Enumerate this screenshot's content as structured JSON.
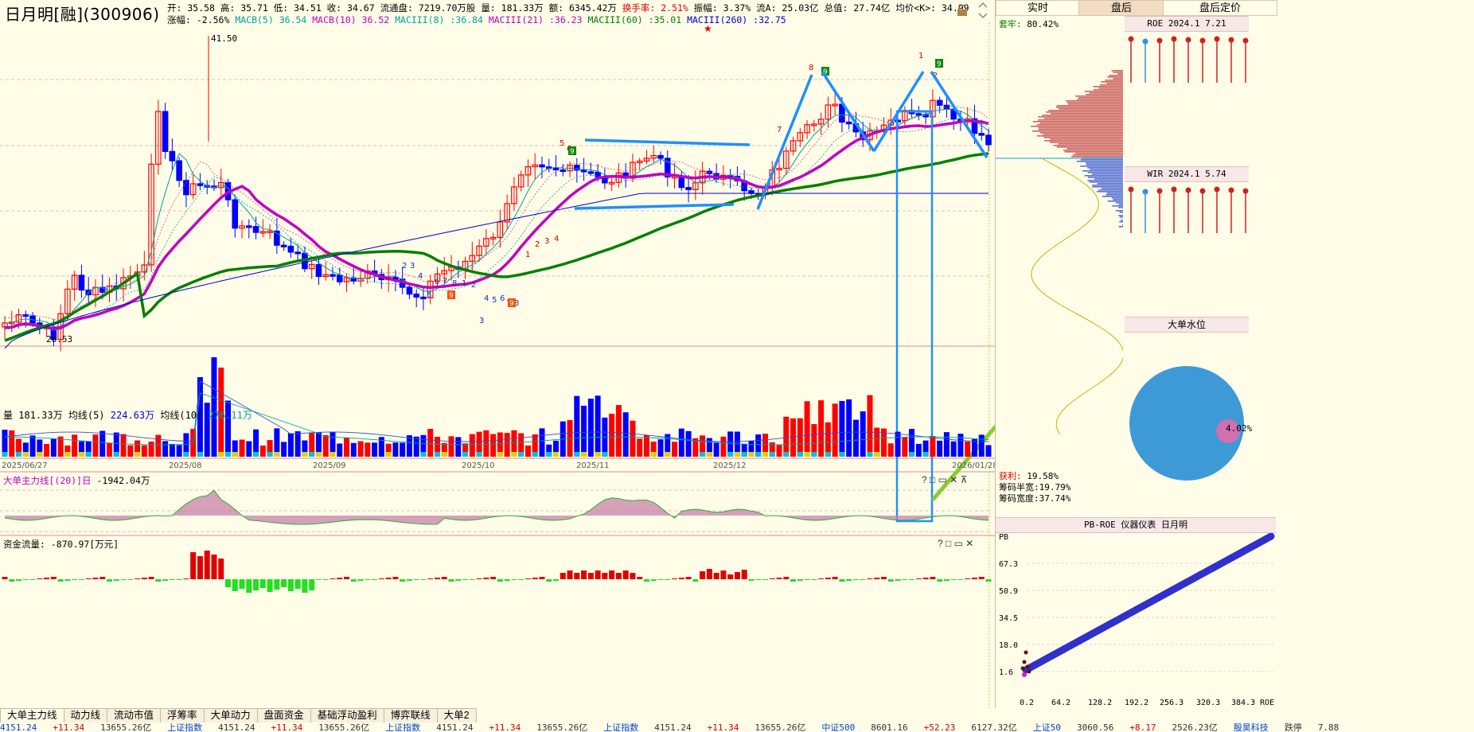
{
  "header": {
    "title": "日月明[融](300906)",
    "ohlc": [
      {
        "label": "开:",
        "value": "35.58"
      },
      {
        "label": "高:",
        "value": "35.71"
      },
      {
        "label": "低:",
        "value": "34.51"
      },
      {
        "label": "收:",
        "value": "34.67"
      },
      {
        "label": "流通盘:",
        "value": "7219.70万股"
      },
      {
        "label": "量:",
        "value": "181.33万"
      },
      {
        "label": "额:",
        "value": "6345.42万"
      },
      {
        "label": "换手率:",
        "value": "2.51%"
      },
      {
        "label": "振幅:",
        "value": "3.37%"
      },
      {
        "label": "流A:",
        "value": "25.03亿"
      },
      {
        "label": "总值:",
        "value": "27.74亿"
      },
      {
        "label": "均价<K>:",
        "value": "34.99"
      }
    ],
    "indicators": [
      {
        "label": "涨幅:",
        "value": "-2.56%",
        "color": "#000000"
      },
      {
        "label": "MACB(5)",
        "value": "36.54",
        "color": "#00a0a0"
      },
      {
        "label": "MACB(10)",
        "value": "36.52",
        "color": "#c000c0"
      },
      {
        "label": "MACIII(8)",
        "value": ":36.84",
        "color": "#00a0a0"
      },
      {
        "label": "MACIII(21)",
        "value": ":36.23",
        "color": "#c000c0"
      },
      {
        "label": "MACIII(60)",
        "value": ":35.01",
        "color": "#008000"
      },
      {
        "label": "MACIII(260)",
        "value": ":32.75",
        "color": "#0000d0"
      }
    ]
  },
  "price_chart": {
    "high_label": "41.50",
    "low_label": "26.53",
    "x_labels": [
      "2025/06/27",
      "2025/08",
      "2025/09",
      "2025/10",
      "2025/11",
      "2025/12",
      "2026/01/28"
    ],
    "td_lows_a": [
      "2",
      "3",
      "4",
      "5",
      "6",
      "7",
      "8",
      "1",
      "2",
      "3",
      "4",
      "5",
      "6",
      "7",
      "8"
    ],
    "td_badge_9": "9"
  },
  "volume": {
    "label": "量",
    "value": "181.33万",
    "ma5_label": "均线(5)",
    "ma5": "224.63万",
    "ma10_label": "均线(10)",
    "ma10": "276.11万"
  },
  "mainforce": {
    "title": "大单主力线[(20)]日",
    "value": "-1942.04万"
  },
  "capflow": {
    "title": "资金流量:",
    "value": "-870.97[万元]"
  },
  "bottom_tabs": [
    "大单主力线",
    "动力线",
    "流动市值",
    "浮筹率",
    "大单动力",
    "盘面资金",
    "基础浮动盈利",
    "博弈联线",
    "大单2"
  ],
  "ticker": [
    {
      "text": "4151.24",
      "c": "blue"
    },
    {
      "text": "+11.34",
      "c": "red"
    },
    {
      "text": "13655.26亿",
      "c": ""
    },
    {
      "text": "上证指数",
      "c": "blue"
    },
    {
      "text": "4151.24",
      "c": ""
    },
    {
      "text": "+11.34",
      "c": "red"
    },
    {
      "text": "13655.26亿",
      "c": ""
    },
    {
      "text": "上证指数",
      "c": "blue"
    },
    {
      "text": "4151.24",
      "c": ""
    },
    {
      "text": "+11.34",
      "c": "red"
    },
    {
      "text": "13655.26亿",
      "c": ""
    },
    {
      "text": "上证指数",
      "c": "blue"
    },
    {
      "text": "4151.24",
      "c": ""
    },
    {
      "text": "+11.34",
      "c": "red"
    },
    {
      "text": "13655.26亿",
      "c": ""
    },
    {
      "text": "中证500",
      "c": "blue"
    },
    {
      "text": "8601.16",
      "c": ""
    },
    {
      "text": "+52.23",
      "c": "red"
    },
    {
      "text": "6127.32亿",
      "c": ""
    },
    {
      "text": "上证50",
      "c": "blue"
    },
    {
      "text": "3060.56",
      "c": ""
    },
    {
      "text": "+8.17",
      "c": "red"
    },
    {
      "text": "2526.23亿",
      "c": ""
    },
    {
      "text": "殷昊科技",
      "c": "blue"
    },
    {
      "text": "跌停",
      "c": ""
    },
    {
      "text": "7.88",
      "c": ""
    }
  ],
  "right": {
    "tabs": [
      "实时",
      "盘后",
      "盘后定价"
    ],
    "active_tab": "盘后",
    "trap_label": "套牢:",
    "trap_value": "80.42%",
    "profit_label": "获利:",
    "profit_value": "19.58%",
    "half_width_label": "筹码半宽:",
    "half_width_value": "19.79%",
    "width_label": "筹码宽度:",
    "width_value": "37.74%",
    "roe_title": "ROE 2024.1 7.21",
    "wir_title": "WIR 2024.1 5.74",
    "big_order_title": "大单水位",
    "pie_value": "4.02%",
    "pbroe_title": "PB-ROE 仪器仪表 日月明",
    "pb_label": "PB",
    "pb_ticks": [
      "67.3",
      "50.9",
      "34.5",
      "18.0",
      "1.6"
    ],
    "roe_ticks": [
      "0.2",
      "64.2",
      "128.2",
      "192.2",
      "256.3",
      "320.3",
      "384.3"
    ],
    "roe_axis_label": "ROE"
  },
  "colors": {
    "up": "#ff0000",
    "down": "#0000ff",
    "ma5": "#00a0a0",
    "ma21": "#c000c0",
    "ma60": "#008000",
    "ma260": "#0000d0",
    "annotation": "#1e90ff",
    "arrow": "#88cc33"
  },
  "icons": [
    "lock-icon",
    "collapse-icon",
    "star-icon",
    "close-icon"
  ]
}
